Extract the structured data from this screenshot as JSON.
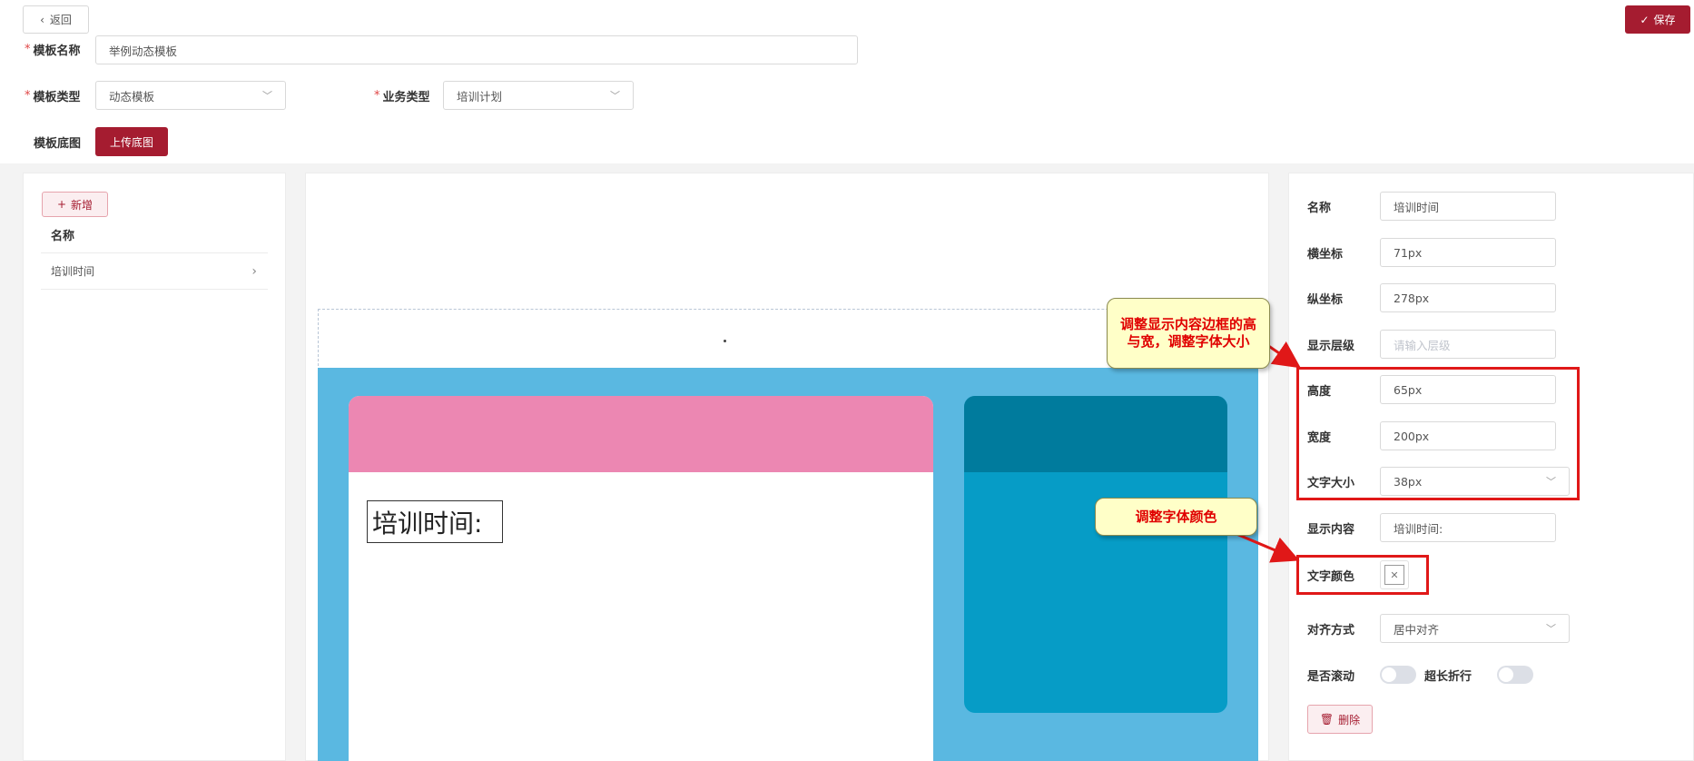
{
  "header": {
    "back_label": "返回",
    "save_label": "保存"
  },
  "form": {
    "template_name_label": "模板名称",
    "template_name_value": "举例动态模板",
    "template_type_label": "模板类型",
    "template_type_value": "动态模板",
    "business_type_label": "业务类型",
    "business_type_value": "培训计划",
    "template_bg_label": "模板底图",
    "upload_label": "上传底图"
  },
  "left_panel": {
    "add_label": "新增",
    "column_header": "名称",
    "items": [
      {
        "label": "培训时间"
      }
    ]
  },
  "canvas": {
    "text_element": "培训时间:",
    "colors": {
      "stage": "#5ab8e1",
      "left_card_header": "#ec87b2",
      "right_card_header": "#007b9d",
      "right_card_body": "#069cc6"
    }
  },
  "props": {
    "name_label": "名称",
    "name_value": "培训时间",
    "x_label": "横坐标",
    "x_value": "71px",
    "y_label": "纵坐标",
    "y_value": "278px",
    "zindex_label": "显示层级",
    "zindex_placeholder": "请输入层级",
    "height_label": "高度",
    "height_value": "65px",
    "width_label": "宽度",
    "width_value": "200px",
    "fontsize_label": "文字大小",
    "fontsize_value": "38px",
    "content_label": "显示内容",
    "content_value": "培训时间:",
    "color_label": "文字颜色",
    "align_label": "对齐方式",
    "align_value": "居中对齐",
    "scroll_label": "是否滚动",
    "scroll_on": false,
    "wrap_label": "超长折行",
    "wrap_on": false,
    "delete_label": "删除"
  },
  "annotations": {
    "callout_size": "调整显示内容边框的高与宽，调整字体大小",
    "callout_color": "调整字体颜色"
  },
  "theme": {
    "primary": "#a51c30",
    "highlight": "#e01818"
  }
}
